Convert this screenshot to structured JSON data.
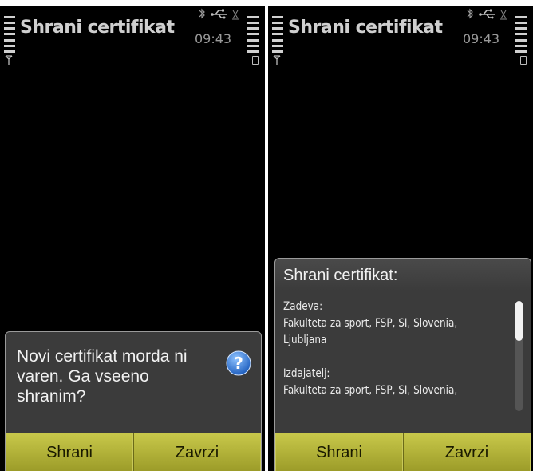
{
  "status": {
    "title": "Shrani certifikat",
    "time": "09:43"
  },
  "left_screen": {
    "query_text": "Novi certifikat morda ni varen. Ga vseeno shranim?",
    "buttons": {
      "save": "Shrani",
      "cancel": "Zavrzi"
    }
  },
  "right_screen": {
    "dialog_title": "Shrani certifikat:",
    "lines": [
      "Zadeva:",
      "Fakulteta za sport, FSP, SI, Slovenia,",
      "Ljubljana",
      "",
      "Izdajatelj:",
      "Fakulteta za sport, FSP, SI, Slovenia,"
    ],
    "buttons": {
      "save": "Shrani",
      "cancel": "Zavrzi"
    },
    "scroll_position": 0.0
  },
  "colors": {
    "softkey": "#b3b33a",
    "dialog": "#3b3b3b",
    "help_icon": "#2f7fd6"
  },
  "icons": [
    "signal-strength-icon",
    "bluetooth-icon",
    "usb-icon",
    "gprs-icon",
    "antenna-icon",
    "battery-icon",
    "help-icon"
  ]
}
